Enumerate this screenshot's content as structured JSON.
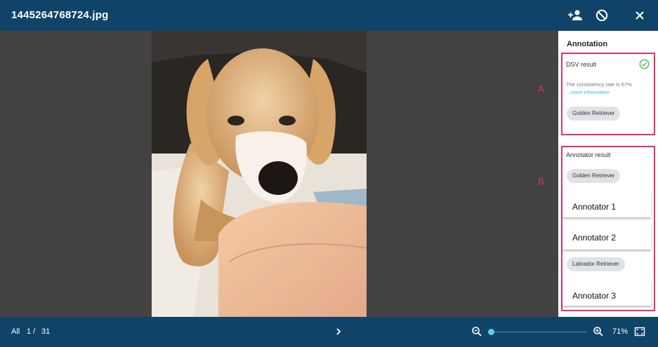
{
  "header": {
    "title": "1445264768724.jpg",
    "icons": [
      "add-person-icon",
      "block-icon",
      "close-icon"
    ]
  },
  "sidebar": {
    "title": "Annotation",
    "dsv": {
      "label": "DSV result",
      "status_icon": "check-circle-icon",
      "status_color": "#4caf50",
      "consistency": "The consistency rate is 67%",
      "more_link": "...more information",
      "chip": "Golden Retriever"
    },
    "annotators": {
      "label": "Annotator result",
      "groups": [
        {
          "chip": "Golden Retriever",
          "names": [
            "Annotator 1",
            "Annotator 2"
          ]
        },
        {
          "chip": "Labrador Retriever",
          "names": [
            "Annotator 3"
          ]
        }
      ]
    }
  },
  "markers": [
    "A",
    "B"
  ],
  "footer": {
    "filter": "All",
    "page": "1 /",
    "total": "31",
    "zoom": "71%",
    "zoom_level": 0.03,
    "next_icon": "chevron-right-icon"
  },
  "colors": {
    "header_bg": "#0f4468",
    "highlight": "#e1306c",
    "link": "#3cb8d8",
    "slider": "#4fd3e8"
  }
}
